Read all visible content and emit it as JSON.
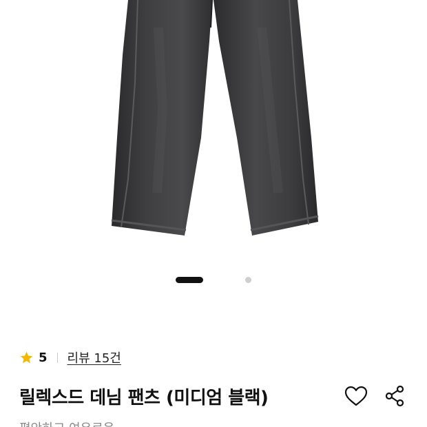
{
  "product": {
    "image_alt": "product-photo-black-denim-pants",
    "carousel": {
      "total_slides": 2,
      "active_index": 0
    },
    "rating": {
      "value": "5",
      "star_color": "#f5b800"
    },
    "review_link": "리뷰 15건",
    "title": "릴렉스드 데님 팬츠 (미디엄 블랙)",
    "subtitle": "편안하고 여유로운"
  },
  "actions": {
    "wishlist_icon": "heart-icon",
    "share_icon": "share-icon"
  }
}
